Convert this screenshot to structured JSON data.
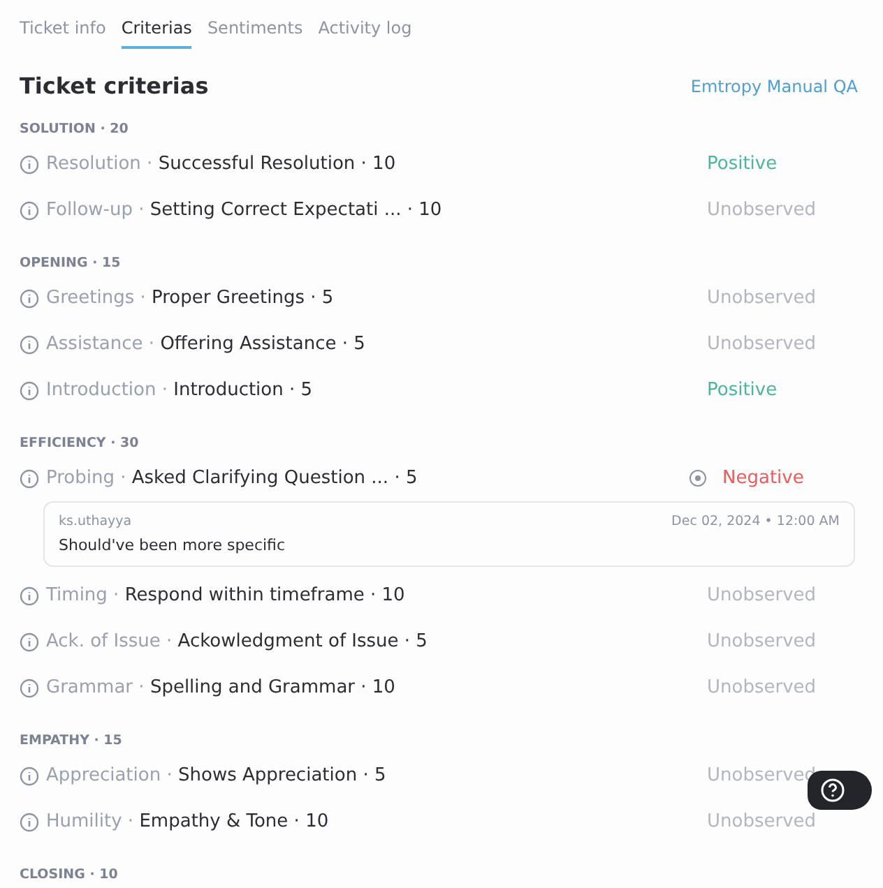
{
  "tabs": [
    {
      "label": "Ticket info",
      "selected": false
    },
    {
      "label": "Criterias",
      "selected": true
    },
    {
      "label": "Sentiments",
      "selected": false
    },
    {
      "label": "Activity log",
      "selected": false
    }
  ],
  "heading": "Ticket criterias",
  "source_link": "Emtropy Manual QA",
  "sections": [
    {
      "title": "SOLUTION · 20",
      "items": [
        {
          "category": "Resolution ·",
          "criterion": "Successful Resolution · 10",
          "status": {
            "label": "Positive",
            "kind": "positive"
          }
        },
        {
          "category": "Follow-up ·",
          "criterion": "Setting Correct Expectati ... · 10",
          "status": {
            "label": "Unobserved",
            "kind": "unobserved"
          }
        }
      ]
    },
    {
      "title": "OPENING · 15",
      "items": [
        {
          "category": "Greetings ·",
          "criterion": "Proper Greetings · 5",
          "status": {
            "label": "Unobserved",
            "kind": "unobserved"
          }
        },
        {
          "category": "Assistance ·",
          "criterion": "Offering Assistance · 5",
          "status": {
            "label": "Unobserved",
            "kind": "unobserved"
          }
        },
        {
          "category": "Introduction ·",
          "criterion": "Introduction · 5",
          "status": {
            "label": "Positive",
            "kind": "positive"
          }
        }
      ]
    },
    {
      "title": "EFFICIENCY · 30",
      "items": [
        {
          "category": "Probing ·",
          "criterion": "Asked Clarifying Question ... · 5",
          "status": {
            "label": "Negative",
            "kind": "negative"
          },
          "comment": {
            "author": "ks.uthayya",
            "time": "Dec 02, 2024 • 12:00 AM",
            "text": "Should've been more specific"
          }
        },
        {
          "category": "Timing ·",
          "criterion": "Respond within timeframe · 10",
          "status": {
            "label": "Unobserved",
            "kind": "unobserved"
          }
        },
        {
          "category": "Ack. of Issue ·",
          "criterion": "Ackowledgment of Issue · 5",
          "status": {
            "label": "Unobserved",
            "kind": "unobserved"
          }
        },
        {
          "category": "Grammar ·",
          "criterion": "Spelling and Grammar · 10",
          "status": {
            "label": "Unobserved",
            "kind": "unobserved"
          }
        }
      ]
    },
    {
      "title": "EMPATHY · 15",
      "items": [
        {
          "category": "Appreciation ·",
          "criterion": "Shows Appreciation · 5",
          "status": {
            "label": "Unobserved",
            "kind": "unobserved"
          }
        },
        {
          "category": "Humility ·",
          "criterion": "Empathy & Tone · 10",
          "status": {
            "label": "Unobserved",
            "kind": "unobserved"
          }
        }
      ]
    },
    {
      "title": "CLOSING · 10"
    }
  ]
}
